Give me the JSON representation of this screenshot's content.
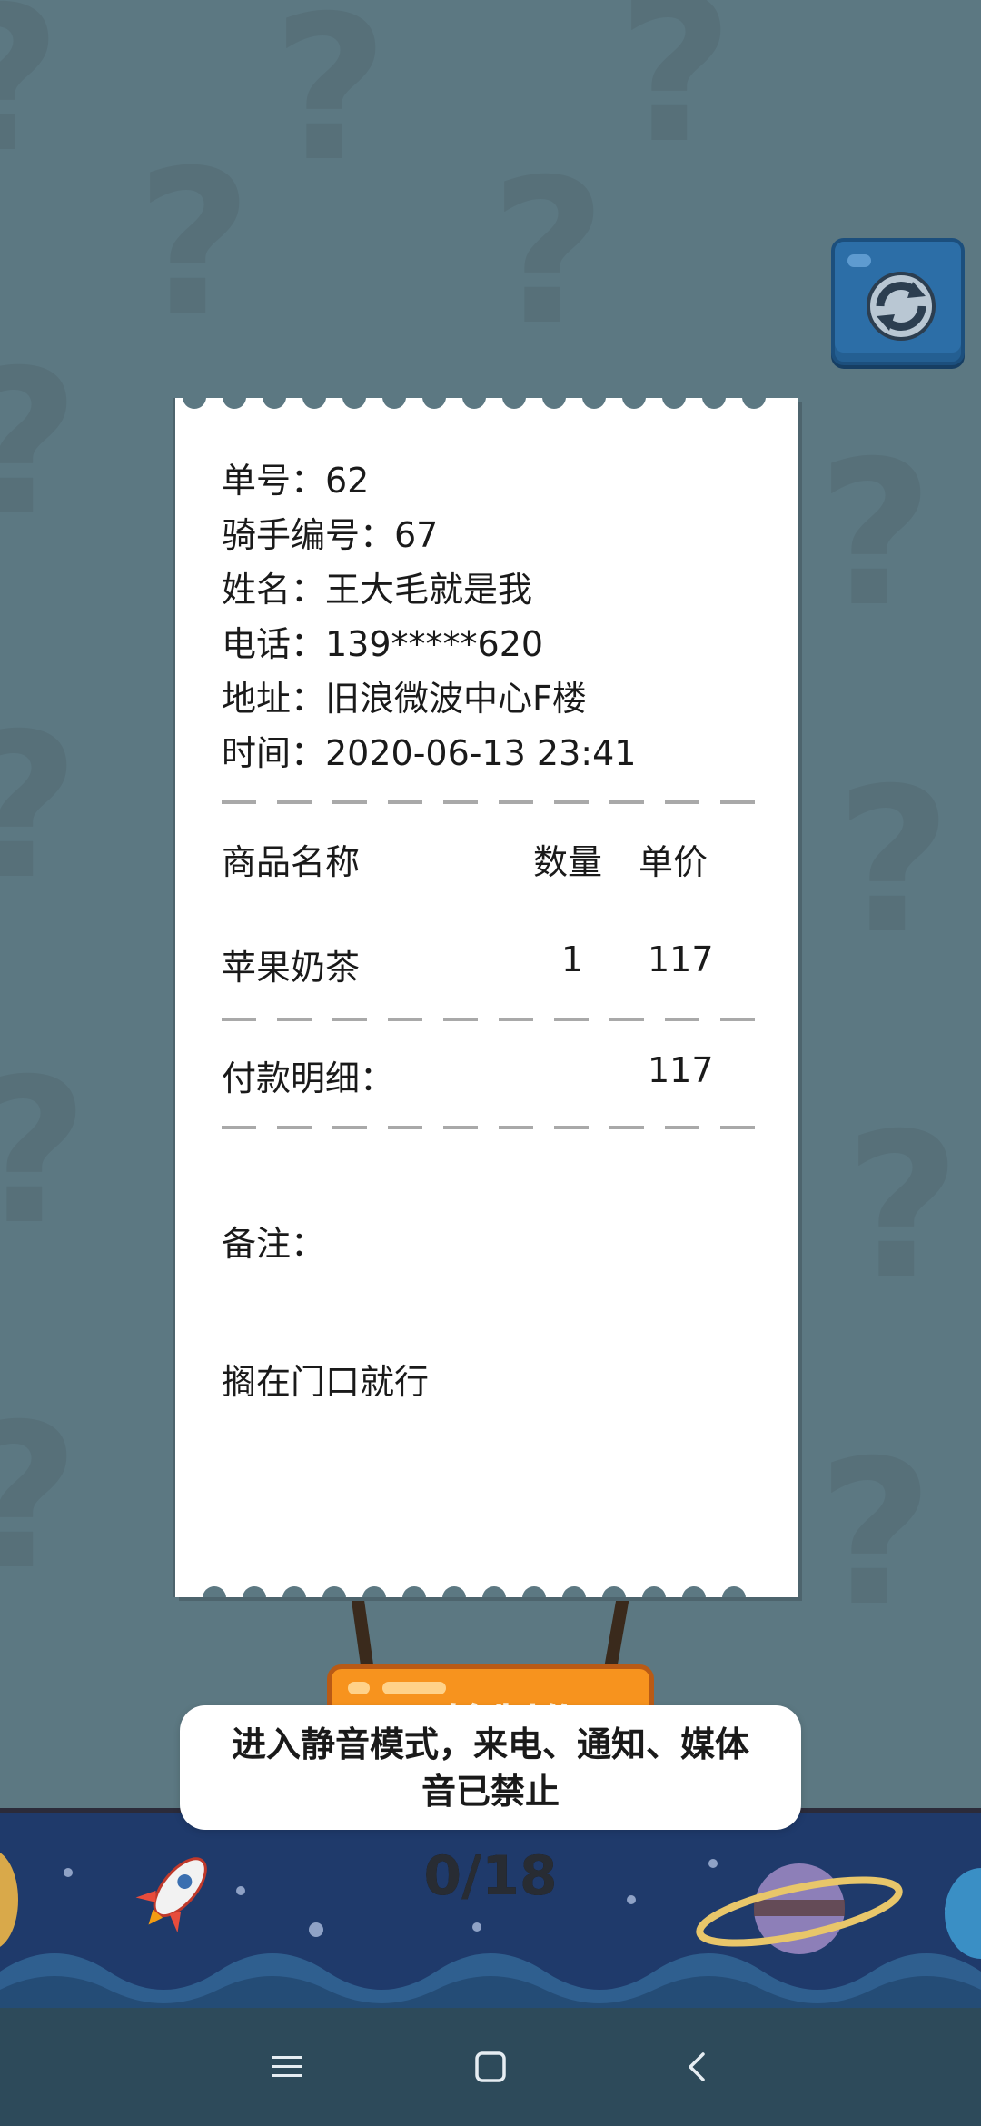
{
  "refresh": {
    "icon": "refresh-icon"
  },
  "receipt": {
    "order_no": "单号：62",
    "rider_no": "骑手编号：67",
    "name": "姓名：王大毛就是我",
    "phone": "电话：139*****620",
    "address": "地址：旧浪微波中心F楼",
    "time": "时间：2020-06-13 23:41",
    "columns": {
      "product": "商品名称",
      "qty": "数量",
      "price": "单价"
    },
    "items": [
      {
        "product": "苹果奶茶",
        "qty": "1",
        "price": "117"
      }
    ],
    "payment_label": "付款明细：",
    "payment_total": "117",
    "note_label": "备注：",
    "note_text": "搁在门口就行"
  },
  "start_button": {
    "label": "开始制作"
  },
  "counter": "0/18",
  "toast": {
    "message": "进入静音模式，来电、通知、媒体音已禁止"
  },
  "navbar": {
    "menu_icon": "menu-icon",
    "home_icon": "home-icon",
    "back_icon": "back-icon"
  },
  "colors": {
    "background": "#5c7882",
    "refresh_button": "#2c6ea7",
    "start_button": "#f7931e",
    "panel": "#1f3a6b",
    "navbar": "#2d4a5a"
  }
}
